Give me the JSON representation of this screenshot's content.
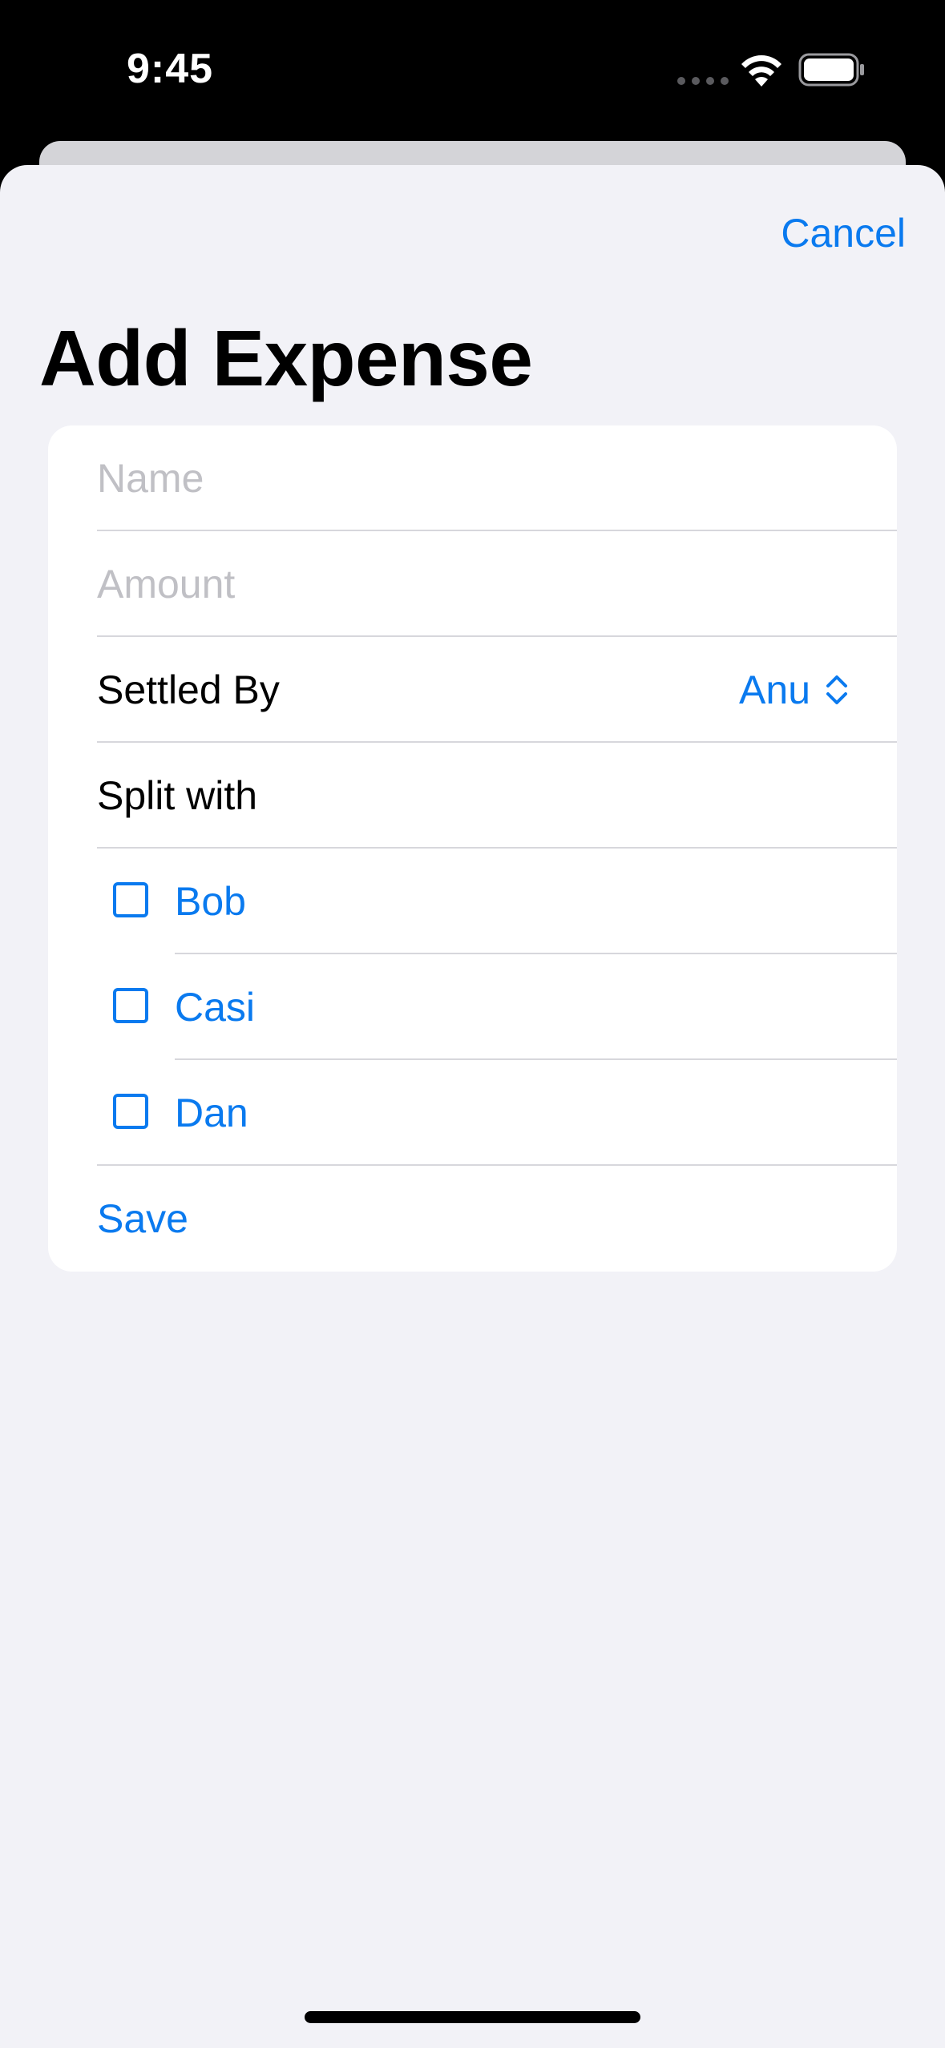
{
  "status_bar": {
    "time": "9:45"
  },
  "sheet": {
    "cancel_label": "Cancel",
    "title": "Add Expense"
  },
  "form": {
    "name_placeholder": "Name",
    "amount_placeholder": "Amount",
    "settled_by_label": "Settled By",
    "settled_by_value": "Anu",
    "split_with_label": "Split with",
    "split_people": [
      {
        "name": "Bob",
        "checked": false
      },
      {
        "name": "Casi",
        "checked": false
      },
      {
        "name": "Dan",
        "checked": false
      }
    ],
    "save_label": "Save"
  },
  "colors": {
    "accent": "#0a7aef",
    "background": "#f2f2f7",
    "card": "#ffffff",
    "placeholder": "#c0c0c5"
  },
  "icons": [
    "wifi-icon",
    "battery-icon",
    "chevron-up-down-icon",
    "checkbox-icon"
  ]
}
